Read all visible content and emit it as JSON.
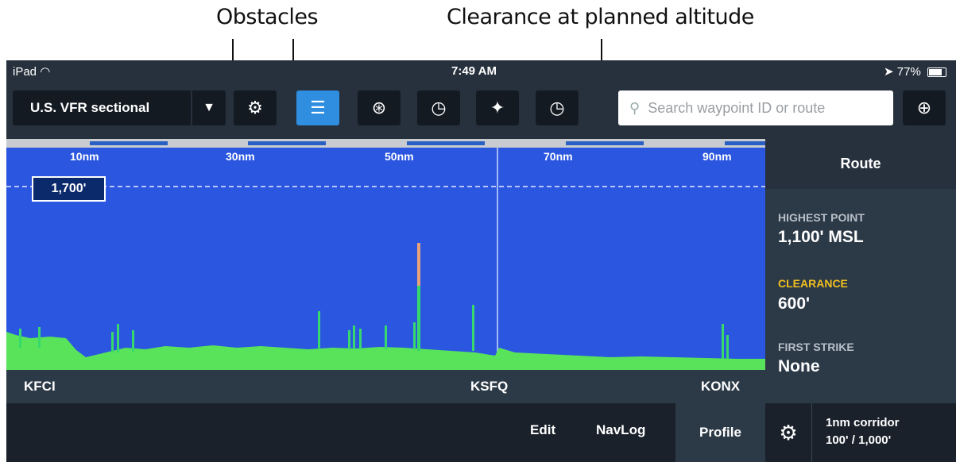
{
  "callouts": {
    "obstacles": "Obstacles",
    "clearance": "Clearance at planned altitude"
  },
  "status_bar": {
    "device": "iPad",
    "wifi_icon": "wifi-icon",
    "time": "7:49 AM",
    "battery": "77%"
  },
  "toolbar": {
    "chart_type": "U.S. VFR sectional",
    "buttons": [
      "dropdown",
      "settings",
      "list",
      "layers",
      "gauge",
      "favorites",
      "clock"
    ],
    "search_placeholder": "Search waypoint ID or route"
  },
  "profile": {
    "distance_labels": [
      "10nm",
      "30nm",
      "50nm",
      "70nm",
      "90nm"
    ],
    "planned_altitude": "1,700'",
    "airports": {
      "start": "KFCI",
      "middle": "KSFQ",
      "end": "KONX"
    }
  },
  "bottom_tabs": {
    "edit": "Edit",
    "navlog": "NavLog",
    "profile": "Profile"
  },
  "route_panel": {
    "title": "Route",
    "highest_point_label": "HIGHEST POINT",
    "highest_point_value": "1,100' MSL",
    "clearance_label": "CLEARANCE",
    "clearance_value": "600'",
    "first_strike_label": "FIRST STRIKE",
    "first_strike_value": "None"
  },
  "corridor": {
    "line1": "1nm corridor",
    "line2": "100' / 1,000'"
  },
  "colors": {
    "sky": "#2a56e0",
    "terrain": "#58e35a",
    "obstacle": "#37d96c",
    "clearance_highlight": "#f0c020"
  }
}
